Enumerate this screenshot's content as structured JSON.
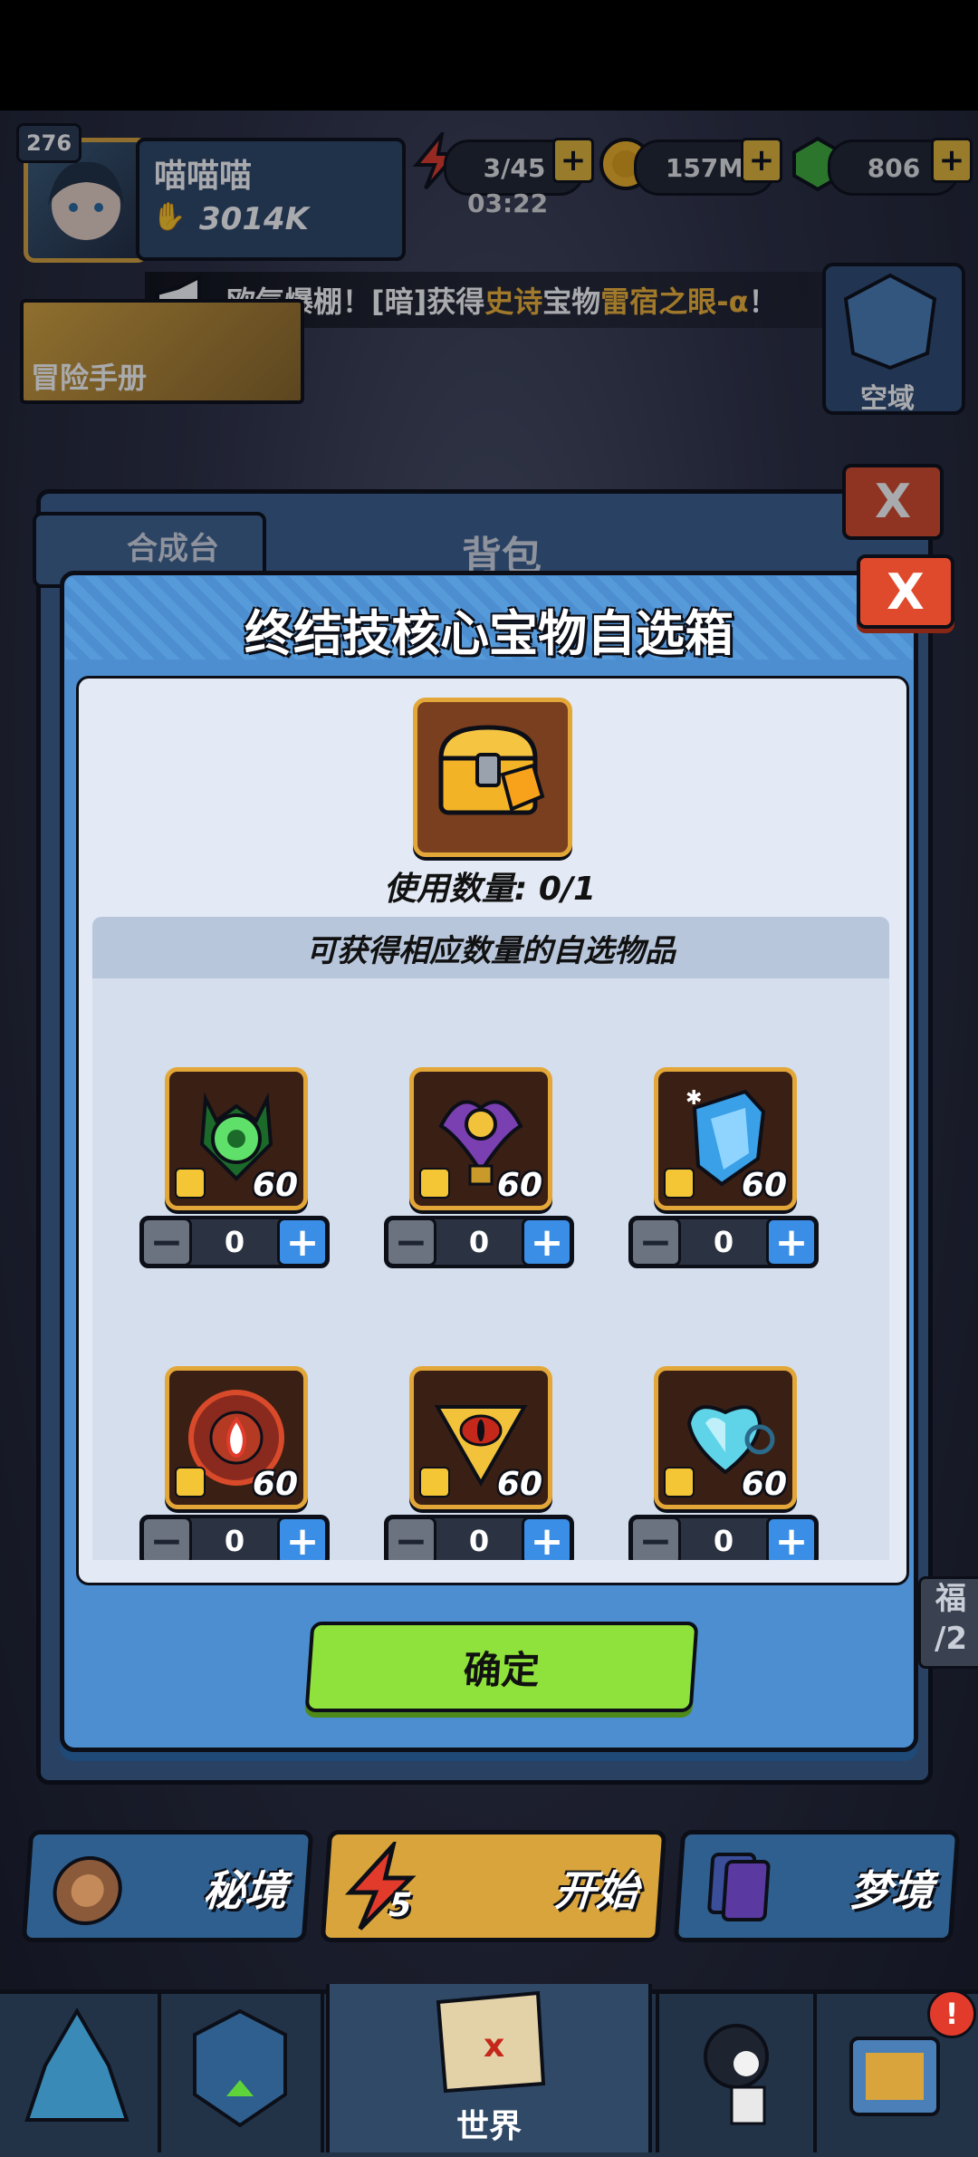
{
  "header": {
    "level": "276",
    "player_name": "喵喵喵",
    "power": "3014K",
    "energy": "3/45",
    "timer": "03:22",
    "gold": "157M",
    "gems": "806",
    "plus": "+"
  },
  "banner": {
    "prefix": "欧气爆棚！[暗]获得",
    "rarity": "史诗",
    "mid": "宝物",
    "item": "雷宿之眼-α",
    "suffix": "！"
  },
  "side": {
    "handbook": "冒险手册",
    "sky_zone": "空域"
  },
  "bag": {
    "tab_label": "合成台",
    "title": "背包",
    "close": "X"
  },
  "dialog": {
    "title": "终结技核心宝物自选箱",
    "close": "X",
    "use_count": "使用数量: 0/1",
    "notice": "可获得相应数量的自选物品",
    "confirm": "确定",
    "minus": "−",
    "plus": "+",
    "items": [
      {
        "count": "60",
        "value": "0",
        "icon": "green-orb-icon",
        "color": "#2f8a3a"
      },
      {
        "count": "60",
        "value": "0",
        "icon": "purple-eye-icon",
        "color": "#6b3d9a"
      },
      {
        "count": "60",
        "value": "0",
        "icon": "ice-shield-icon",
        "color": "#2f6fb3"
      },
      {
        "count": "60",
        "value": "0",
        "icon": "fire-seal-icon",
        "color": "#8a2a1e"
      },
      {
        "count": "60",
        "value": "0",
        "icon": "golden-eye-icon",
        "color": "#b68a1e"
      },
      {
        "count": "60",
        "value": "0",
        "icon": "ice-heart-icon",
        "color": "#2a7a9a"
      }
    ]
  },
  "bottom": {
    "secret_realm": "秘境",
    "start": "开始",
    "start_cost": "5",
    "dream_realm": "梦境",
    "world": "世界",
    "alert": "!",
    "right_tag": "福\n/2"
  }
}
